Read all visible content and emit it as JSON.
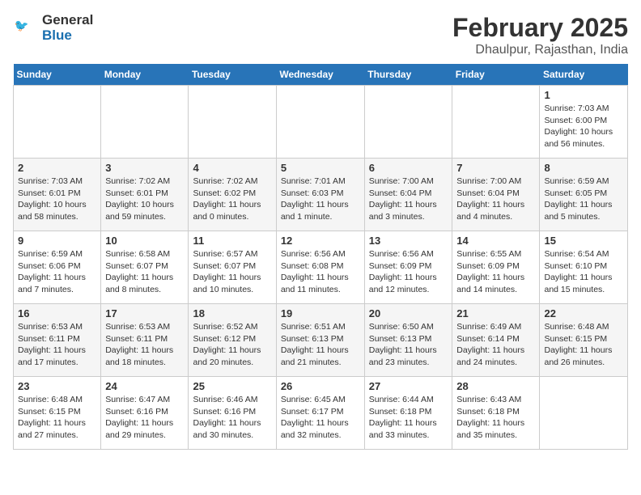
{
  "logo": {
    "line1": "General",
    "line2": "Blue"
  },
  "title": "February 2025",
  "location": "Dhaulpur, Rajasthan, India",
  "weekdays": [
    "Sunday",
    "Monday",
    "Tuesday",
    "Wednesday",
    "Thursday",
    "Friday",
    "Saturday"
  ],
  "weeks": [
    [
      {
        "day": "",
        "info": ""
      },
      {
        "day": "",
        "info": ""
      },
      {
        "day": "",
        "info": ""
      },
      {
        "day": "",
        "info": ""
      },
      {
        "day": "",
        "info": ""
      },
      {
        "day": "",
        "info": ""
      },
      {
        "day": "1",
        "info": "Sunrise: 7:03 AM\nSunset: 6:00 PM\nDaylight: 10 hours and 56 minutes."
      }
    ],
    [
      {
        "day": "2",
        "info": "Sunrise: 7:03 AM\nSunset: 6:01 PM\nDaylight: 10 hours and 58 minutes."
      },
      {
        "day": "3",
        "info": "Sunrise: 7:02 AM\nSunset: 6:01 PM\nDaylight: 10 hours and 59 minutes."
      },
      {
        "day": "4",
        "info": "Sunrise: 7:02 AM\nSunset: 6:02 PM\nDaylight: 11 hours and 0 minutes."
      },
      {
        "day": "5",
        "info": "Sunrise: 7:01 AM\nSunset: 6:03 PM\nDaylight: 11 hours and 1 minute."
      },
      {
        "day": "6",
        "info": "Sunrise: 7:00 AM\nSunset: 6:04 PM\nDaylight: 11 hours and 3 minutes."
      },
      {
        "day": "7",
        "info": "Sunrise: 7:00 AM\nSunset: 6:04 PM\nDaylight: 11 hours and 4 minutes."
      },
      {
        "day": "8",
        "info": "Sunrise: 6:59 AM\nSunset: 6:05 PM\nDaylight: 11 hours and 5 minutes."
      }
    ],
    [
      {
        "day": "9",
        "info": "Sunrise: 6:59 AM\nSunset: 6:06 PM\nDaylight: 11 hours and 7 minutes."
      },
      {
        "day": "10",
        "info": "Sunrise: 6:58 AM\nSunset: 6:07 PM\nDaylight: 11 hours and 8 minutes."
      },
      {
        "day": "11",
        "info": "Sunrise: 6:57 AM\nSunset: 6:07 PM\nDaylight: 11 hours and 10 minutes."
      },
      {
        "day": "12",
        "info": "Sunrise: 6:56 AM\nSunset: 6:08 PM\nDaylight: 11 hours and 11 minutes."
      },
      {
        "day": "13",
        "info": "Sunrise: 6:56 AM\nSunset: 6:09 PM\nDaylight: 11 hours and 12 minutes."
      },
      {
        "day": "14",
        "info": "Sunrise: 6:55 AM\nSunset: 6:09 PM\nDaylight: 11 hours and 14 minutes."
      },
      {
        "day": "15",
        "info": "Sunrise: 6:54 AM\nSunset: 6:10 PM\nDaylight: 11 hours and 15 minutes."
      }
    ],
    [
      {
        "day": "16",
        "info": "Sunrise: 6:53 AM\nSunset: 6:11 PM\nDaylight: 11 hours and 17 minutes."
      },
      {
        "day": "17",
        "info": "Sunrise: 6:53 AM\nSunset: 6:11 PM\nDaylight: 11 hours and 18 minutes."
      },
      {
        "day": "18",
        "info": "Sunrise: 6:52 AM\nSunset: 6:12 PM\nDaylight: 11 hours and 20 minutes."
      },
      {
        "day": "19",
        "info": "Sunrise: 6:51 AM\nSunset: 6:13 PM\nDaylight: 11 hours and 21 minutes."
      },
      {
        "day": "20",
        "info": "Sunrise: 6:50 AM\nSunset: 6:13 PM\nDaylight: 11 hours and 23 minutes."
      },
      {
        "day": "21",
        "info": "Sunrise: 6:49 AM\nSunset: 6:14 PM\nDaylight: 11 hours and 24 minutes."
      },
      {
        "day": "22",
        "info": "Sunrise: 6:48 AM\nSunset: 6:15 PM\nDaylight: 11 hours and 26 minutes."
      }
    ],
    [
      {
        "day": "23",
        "info": "Sunrise: 6:48 AM\nSunset: 6:15 PM\nDaylight: 11 hours and 27 minutes."
      },
      {
        "day": "24",
        "info": "Sunrise: 6:47 AM\nSunset: 6:16 PM\nDaylight: 11 hours and 29 minutes."
      },
      {
        "day": "25",
        "info": "Sunrise: 6:46 AM\nSunset: 6:16 PM\nDaylight: 11 hours and 30 minutes."
      },
      {
        "day": "26",
        "info": "Sunrise: 6:45 AM\nSunset: 6:17 PM\nDaylight: 11 hours and 32 minutes."
      },
      {
        "day": "27",
        "info": "Sunrise: 6:44 AM\nSunset: 6:18 PM\nDaylight: 11 hours and 33 minutes."
      },
      {
        "day": "28",
        "info": "Sunrise: 6:43 AM\nSunset: 6:18 PM\nDaylight: 11 hours and 35 minutes."
      },
      {
        "day": "",
        "info": ""
      }
    ]
  ]
}
